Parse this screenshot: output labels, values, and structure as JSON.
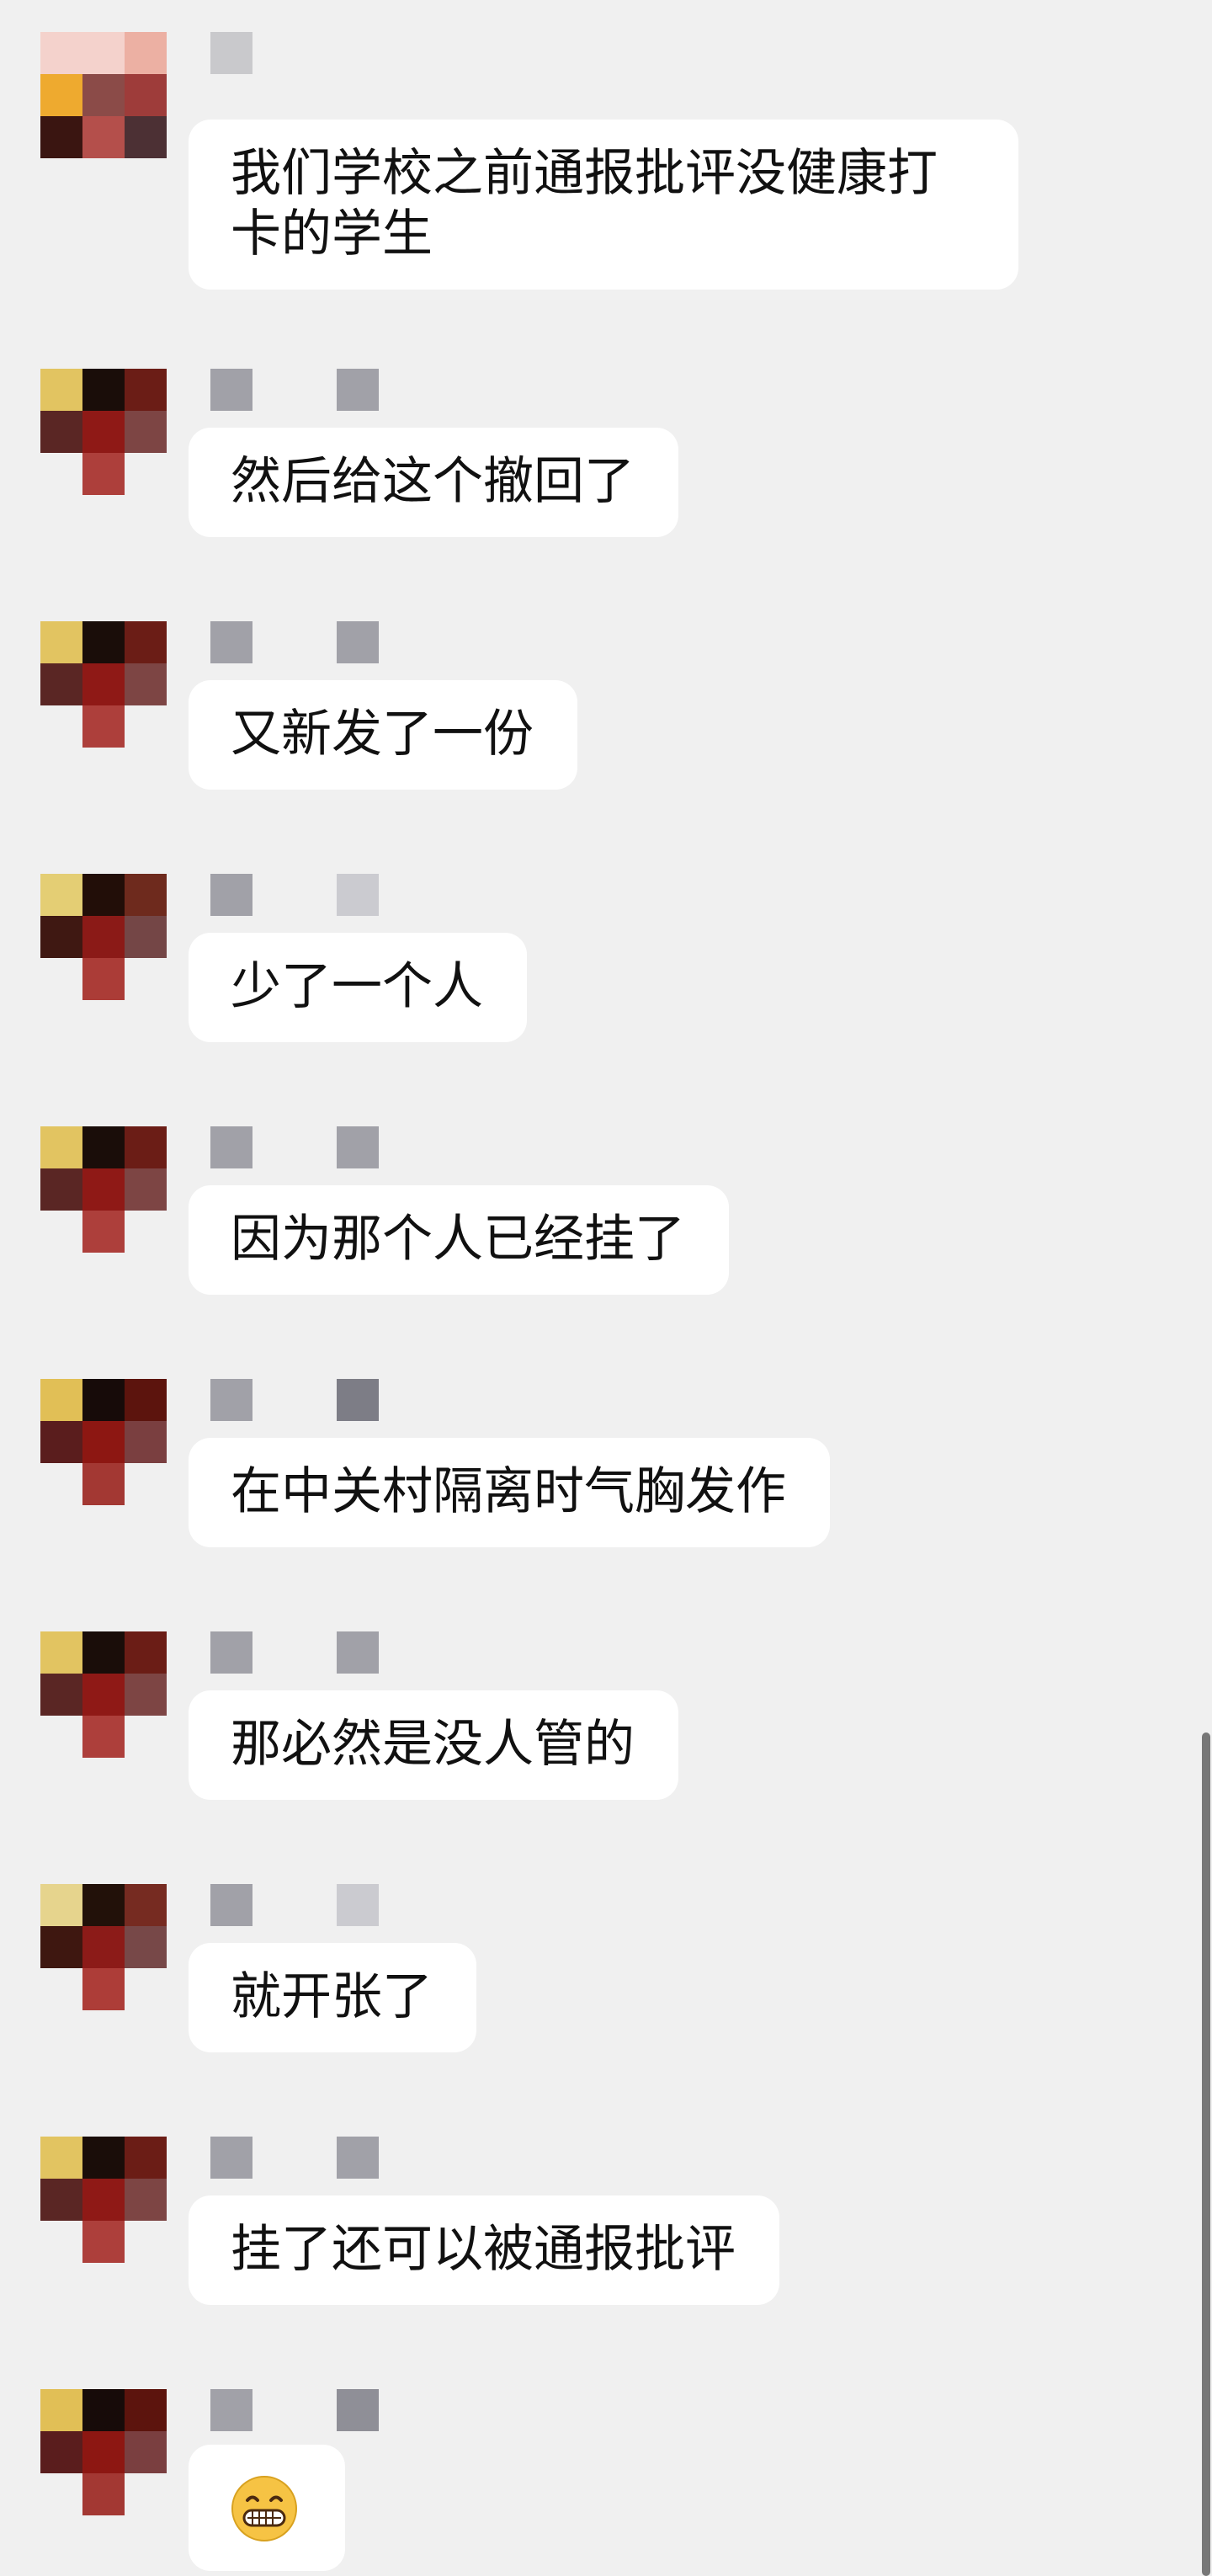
{
  "app": {
    "type": "chat"
  },
  "messages": [
    {
      "avatar_colors": [
        "#f4d2cc",
        "#f4d2cc",
        "#ecb0a3",
        "#eeaa2f",
        "#8b4b48",
        "#9e3c3a",
        "#3a1511",
        "#b44f4b",
        "#4c3034"
      ],
      "name_blocks": [
        "#c9c9cc"
      ],
      "text": "我们学校之前通报批评没健康打卡的学生",
      "variant": "multi"
    },
    {
      "avatar_colors": [
        "#e2c461",
        "#1a0d09",
        "#6b1d16",
        "#5a2624",
        "#8f1916",
        "#7d4544",
        "#f0f0f0",
        "#ad3f3b",
        "#f0f0f0"
      ],
      "name_blocks": [
        "#a1a1a8",
        "#a1a1a8"
      ],
      "text": "然后给这个撤回了",
      "variant": "single"
    },
    {
      "avatar_colors": [
        "#e2c461",
        "#1a0d09",
        "#6b1d16",
        "#5a2624",
        "#8f1916",
        "#7d4544",
        "#f0f0f0",
        "#ad3f3b",
        "#f0f0f0"
      ],
      "name_blocks": [
        "#a1a1a8",
        "#a1a1a8"
      ],
      "text": "又新发了一份",
      "variant": "single"
    },
    {
      "avatar_colors": [
        "#e4ce74",
        "#220e08",
        "#6e2a1d",
        "#3f1812",
        "#8b1a17",
        "#744646",
        "#f0f0f0",
        "#ab3c37",
        "#f0f0f0"
      ],
      "name_blocks": [
        "#a1a1a8",
        "#cbcbd0"
      ],
      "text": "少了一个人",
      "variant": "single"
    },
    {
      "avatar_colors": [
        "#e2c461",
        "#1a0d09",
        "#6b1d16",
        "#5a2624",
        "#8f1916",
        "#7d4544",
        "#f0f0f0",
        "#ad3f3b",
        "#f0f0f0"
      ],
      "name_blocks": [
        "#a1a1a8",
        "#a1a1a8"
      ],
      "text": "因为那个人已经挂了",
      "variant": "single"
    },
    {
      "avatar_colors": [
        "#e1bf56",
        "#170b09",
        "#5c140d",
        "#5a1d1d",
        "#8d1712",
        "#7a3f40",
        "#f0f0f0",
        "#a33833",
        "#f0f0f0"
      ],
      "name_blocks": [
        "#a1a1a8",
        "#7d7d86"
      ],
      "text": "在中关村隔离时气胸发作",
      "variant": "single"
    },
    {
      "avatar_colors": [
        "#e2c461",
        "#1a0d09",
        "#6b1d16",
        "#5a2624",
        "#8f1916",
        "#7d4544",
        "#f0f0f0",
        "#ad3f3b",
        "#f0f0f0"
      ],
      "name_blocks": [
        "#a1a1a8",
        "#a1a1a8"
      ],
      "text": "那必然是没人管的",
      "variant": "single"
    },
    {
      "avatar_colors": [
        "#e6d48d",
        "#221109",
        "#762b21",
        "#3e1710",
        "#8c1b18",
        "#774848",
        "#f0f0f0",
        "#ad3d38",
        "#f0f0f0"
      ],
      "name_blocks": [
        "#a1a1a8",
        "#cbcbd0"
      ],
      "text": "就开张了",
      "variant": "single"
    },
    {
      "avatar_colors": [
        "#e2c461",
        "#1a0d09",
        "#6b1d16",
        "#5a2624",
        "#8f1916",
        "#7d4544",
        "#f0f0f0",
        "#ad3f3b",
        "#f0f0f0"
      ],
      "name_blocks": [
        "#a1a1a8",
        "#a1a1a8"
      ],
      "text": "挂了还可以被通报批评",
      "variant": "single"
    },
    {
      "avatar_colors": [
        "#e1bf56",
        "#170b09",
        "#5c140d",
        "#5a1d1d",
        "#8d1712",
        "#7a3f40",
        "#f0f0f0",
        "#a33833",
        "#f0f0f0"
      ],
      "name_blocks": [
        "#a1a1a8",
        "#8f8f97"
      ],
      "text": "😁",
      "variant": "emoji"
    }
  ],
  "scrollbar": {
    "visible": true
  }
}
